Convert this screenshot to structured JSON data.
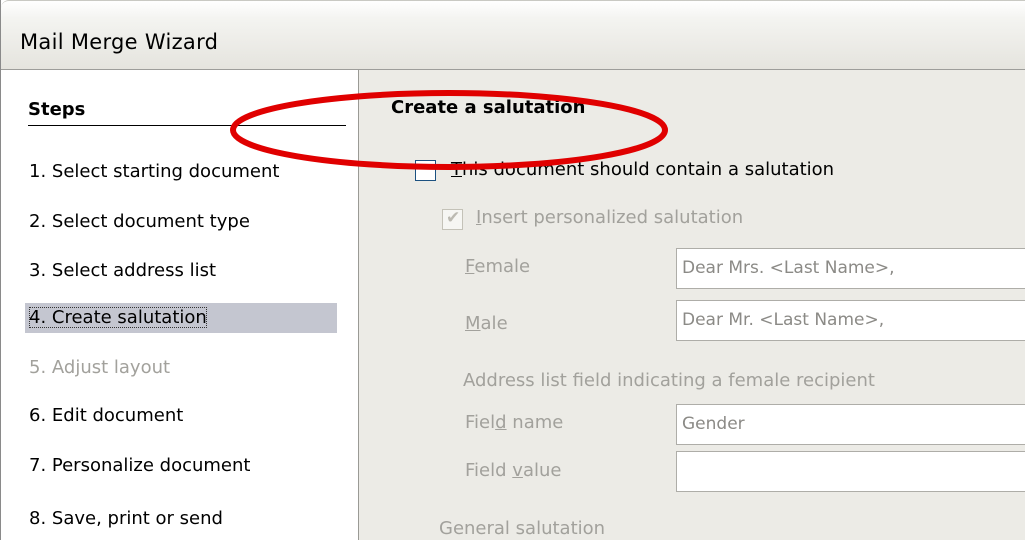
{
  "window": {
    "title": "Mail Merge Wizard"
  },
  "steps": {
    "header": "Steps",
    "items": [
      {
        "label": "1.  Select starting document",
        "state": "normal"
      },
      {
        "label": "2.  Select document type",
        "state": "normal"
      },
      {
        "label": "3.  Select address list",
        "state": "normal"
      },
      {
        "label": "4.  Create salutation",
        "state": "active"
      },
      {
        "label": "5.  Adjust layout",
        "state": "disabled"
      },
      {
        "label": "6.  Edit document",
        "state": "normal"
      },
      {
        "label": "7.  Personalize document",
        "state": "normal"
      },
      {
        "label": "8.  Save, print or send",
        "state": "normal"
      }
    ]
  },
  "content": {
    "section_title": "Create a salutation",
    "contain_salutation": {
      "label_first": "T",
      "label_rest": "his document should contain a salutation",
      "checked": false
    },
    "insert_personalized": {
      "label_first": "I",
      "label_rest": "nsert personalized salutation",
      "checked": true,
      "enabled": false
    },
    "female": {
      "label_first": "F",
      "label_rest": "emale",
      "value": "Dear Mrs. <Last Name>,"
    },
    "male": {
      "label_first": "M",
      "label_rest": "ale",
      "value": "Dear Mr. <Last Name>,"
    },
    "address_field_heading": "Address list field indicating a female recipient",
    "field_name": {
      "label_before": "Fiel",
      "label_u": "d",
      "label_after": " name",
      "value": "Gender"
    },
    "field_value": {
      "label_before": "Field ",
      "label_u": "v",
      "label_after": "alue",
      "value": ""
    },
    "general_salutation": "General salutation"
  },
  "annotation": {
    "shape": "ellipse",
    "color": "#e00000"
  }
}
